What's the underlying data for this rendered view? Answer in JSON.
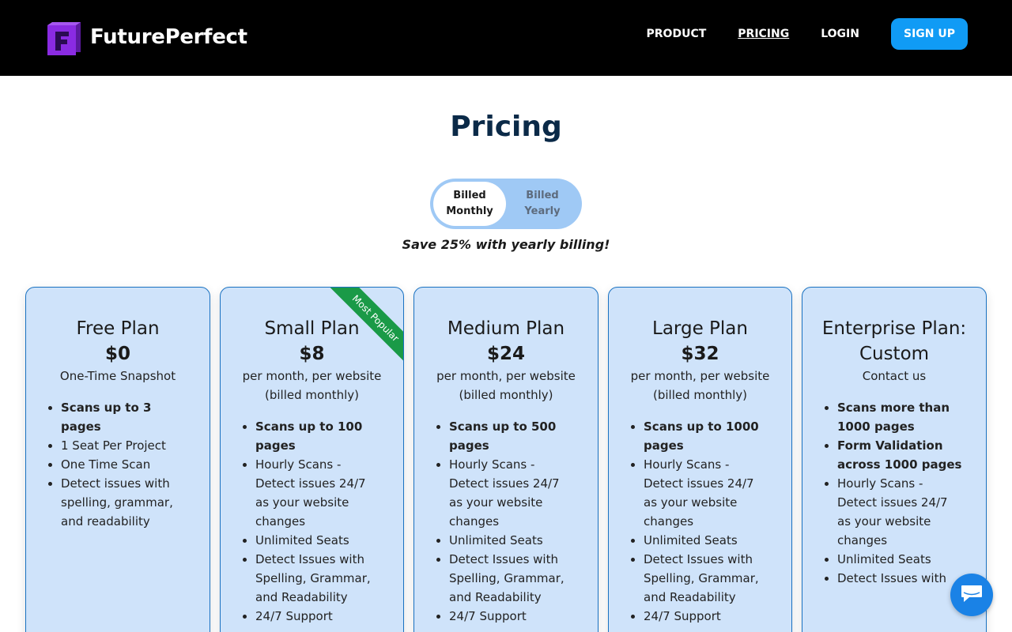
{
  "header": {
    "brand": "FuturePerfect",
    "nav": [
      {
        "label": "PRODUCT"
      },
      {
        "label": "PRICING"
      },
      {
        "label": "LOGIN"
      }
    ],
    "signup_label": "SIGN UP"
  },
  "main": {
    "title": "Pricing",
    "toggle": {
      "monthly_line1": "Billed",
      "monthly_line2": "Monthly",
      "yearly_line1": "Billed",
      "yearly_line2": "Yearly"
    },
    "save_note": "Save 25% with yearly billing!",
    "ribbon": "Most Popular",
    "plans": [
      {
        "name": "Free Plan",
        "price": "$0",
        "sub": "One-Time Snapshot",
        "features": [
          "Scans up to 3 pages",
          "1 Seat Per Project",
          "One Time Scan",
          "Detect issues with spelling, grammar, and readability"
        ]
      },
      {
        "name": "Small Plan",
        "price": "$8",
        "sub": "per month, per website (billed monthly)",
        "features": [
          "Scans up to 100 pages",
          "Hourly Scans - Detect issues 24/7 as your website changes",
          "Unlimited Seats",
          "Detect Issues with Spelling, Grammar, and Readability",
          "24/7 Support"
        ]
      },
      {
        "name": "Medium Plan",
        "price": "$24",
        "sub": "per month, per website (billed monthly)",
        "features": [
          "Scans up to 500 pages",
          "Hourly Scans - Detect issues 24/7 as your website changes",
          "Unlimited Seats",
          "Detect Issues with Spelling, Grammar, and Readability",
          "24/7 Support"
        ]
      },
      {
        "name": "Large Plan",
        "price": "$32",
        "sub": "per month, per website (billed monthly)",
        "features": [
          "Scans up to 1000 pages",
          "Hourly Scans - Detect issues 24/7 as your website changes",
          "Unlimited Seats",
          "Detect Issues with Spelling, Grammar, and Readability",
          "24/7 Support"
        ]
      },
      {
        "name": "Enterprise Plan: Custom",
        "price": "",
        "sub": "Contact us",
        "features": [
          "Scans more than 1000 pages",
          "Form Validation across 1000 pages",
          "Hourly Scans - Detect issues 24/7 as your website changes",
          "Unlimited Seats",
          "Detect Issues with"
        ]
      }
    ]
  },
  "colors": {
    "header_bg": "#000000",
    "accent": "#109bf5",
    "card_bg": "#cfe3fa",
    "ribbon": "#1a9a47",
    "title": "#0b2a48",
    "logo_purple": "#8a2be2"
  },
  "icons": {
    "logo": "futureperfect-logo-icon",
    "chat": "chat-icon"
  }
}
